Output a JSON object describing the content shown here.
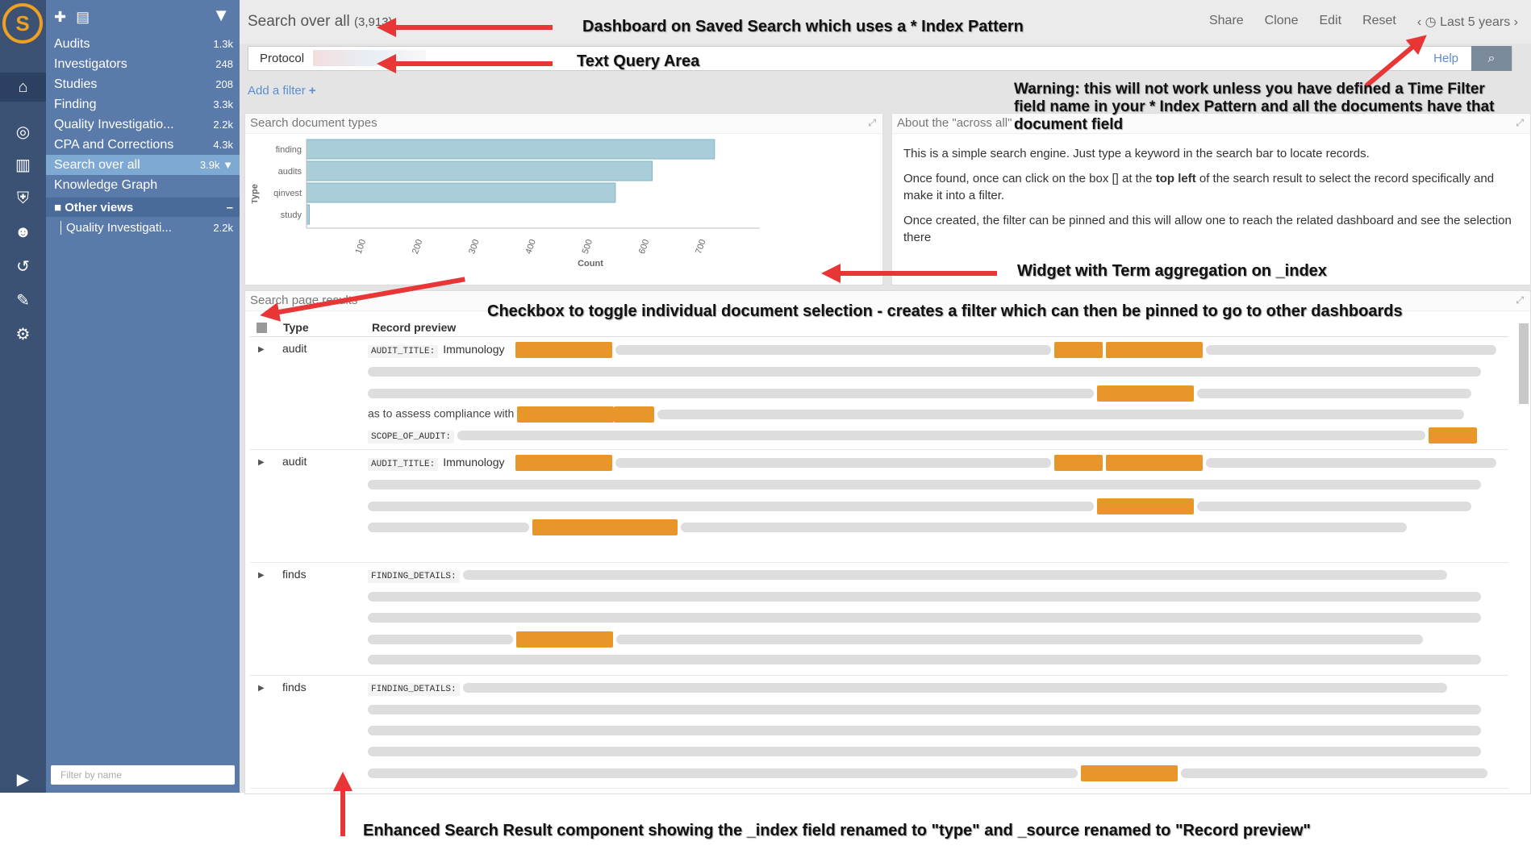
{
  "sidebar": {
    "items": [
      {
        "label": "Audits",
        "count": "1.3k"
      },
      {
        "label": "Investigators",
        "count": "248"
      },
      {
        "label": "Studies",
        "count": "208"
      },
      {
        "label": "Finding",
        "count": "3.3k"
      },
      {
        "label": "Quality Investigatio...",
        "count": "2.2k"
      },
      {
        "label": "CPA and Corrections",
        "count": "4.3k"
      },
      {
        "label": "Search over all",
        "count": "3.9k"
      },
      {
        "label": "Knowledge Graph",
        "count": ""
      }
    ],
    "group_label": "Other views",
    "group_items": [
      {
        "label": "Quality Investigati...",
        "count": "2.2k"
      }
    ],
    "filter_placeholder": "Filter by name"
  },
  "header": {
    "title": "Search over all",
    "count": "(3,913)",
    "actions": [
      "Share",
      "Clone",
      "Edit",
      "Reset"
    ],
    "time": "Last 5 years"
  },
  "query": {
    "value": "Protocol",
    "help": "Help"
  },
  "add_filter": "Add a filter",
  "panel_types": {
    "title": "Search document types"
  },
  "panel_about": {
    "title": "About the \"across all\"",
    "p1": "This is a simple search engine. Just type a keyword in the search bar to locate records.",
    "p2a": "Once found, once can click on the box [] at the ",
    "p2b": "top left",
    "p2c": " of the search result to select the record specifically and make it into a filter.",
    "p3": "Once created, the filter can be pinned and this will allow one to reach the related dashboard and see the selection there"
  },
  "panel_results": {
    "title": "Search page results",
    "col_type": "Type",
    "col_preview": "Record preview",
    "rows": [
      {
        "type": "audit",
        "field": "AUDIT_TITLE:",
        "value": "Immunology",
        "field2": "SCOPE_OF_AUDIT:",
        "line": "as to assess compliance with"
      },
      {
        "type": "audit",
        "field": "AUDIT_TITLE:",
        "value": "Immunology",
        "field2": "",
        "line": ""
      },
      {
        "type": "finds",
        "field": "FINDING_DETAILS:",
        "value": "",
        "field2": "",
        "line": ""
      },
      {
        "type": "finds",
        "field": "FINDING_DETAILS:",
        "value": "",
        "field2": "",
        "line": ""
      }
    ]
  },
  "chart_data": {
    "type": "bar",
    "orientation": "horizontal",
    "categories": [
      "finding",
      "audits",
      "qinvest",
      "study"
    ],
    "values": [
      720,
      610,
      545,
      5
    ],
    "xlabel": "Count",
    "ylabel": "Type",
    "ticks": [
      100,
      200,
      300,
      400,
      500,
      600,
      700
    ],
    "xlim": [
      0,
      800
    ]
  },
  "annotations": {
    "a1": "Dashboard on Saved Search which uses a * Index Pattern",
    "a2": "Text Query Area",
    "a3": "Warning: this will not work unless you have defined a Time Filter field name in your *  Index Pattern and all the documents have that document field",
    "a4": "Widget with Term aggregation on _index",
    "a5": "Checkbox to toggle individual document selection - creates a filter which can then be pinned to go to other dashboards",
    "a6": "Enhanced Search Result component showing the _index field renamed to \"type\" and _source renamed to \"Record preview\""
  }
}
